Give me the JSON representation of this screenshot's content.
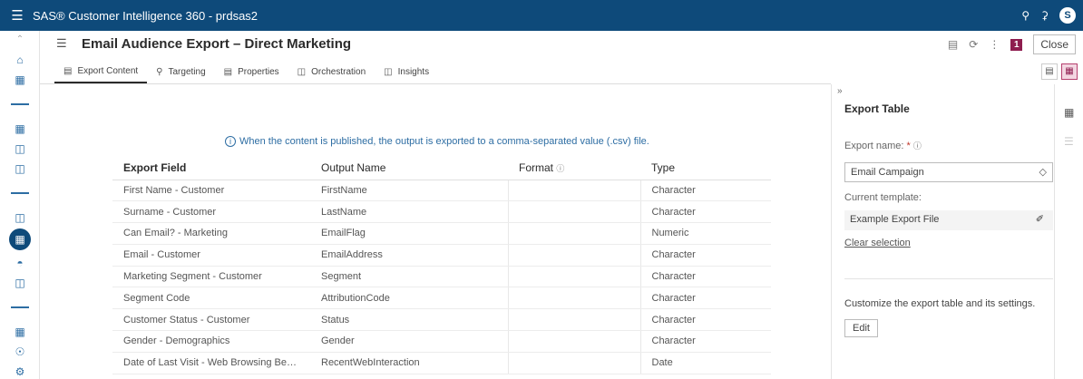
{
  "topbar": {
    "app_title": "SAS® Customer Intelligence 360 - prdsas2",
    "avatar_letter": "S"
  },
  "header": {
    "title": "Email Audience Export – Direct Marketing",
    "badge_count": "1",
    "close_label": "Close"
  },
  "tabs": [
    {
      "label": "Export Content",
      "icon": "document-icon"
    },
    {
      "label": "Targeting",
      "icon": "target-icon"
    },
    {
      "label": "Properties",
      "icon": "properties-icon"
    },
    {
      "label": "Orchestration",
      "icon": "orchestration-icon"
    },
    {
      "label": "Insights",
      "icon": "insights-icon"
    }
  ],
  "main": {
    "info_text": "When the content is published, the output is exported to a comma-separated value (.csv) file.",
    "columns": [
      "Export Field",
      "Output Name",
      "Format",
      "Type"
    ],
    "rows": [
      {
        "field": "First Name - Customer",
        "output": "FirstName",
        "format": "",
        "type": "Character"
      },
      {
        "field": "Surname - Customer",
        "output": "LastName",
        "format": "",
        "type": "Character"
      },
      {
        "field": "Can Email? - Marketing",
        "output": "EmailFlag",
        "format": "",
        "type": "Numeric"
      },
      {
        "field": "Email - Customer",
        "output": "EmailAddress",
        "format": "",
        "type": "Character"
      },
      {
        "field": "Marketing Segment - Customer",
        "output": "Segment",
        "format": "",
        "type": "Character"
      },
      {
        "field": "Segment Code",
        "output": "AttributionCode",
        "format": "",
        "type": "Character"
      },
      {
        "field": "Customer Status - Customer",
        "output": "Status",
        "format": "",
        "type": "Character"
      },
      {
        "field": "Gender - Demographics",
        "output": "Gender",
        "format": "",
        "type": "Character"
      },
      {
        "field": "Date of Last Visit - Web Browsing Be…",
        "output": "RecentWebInteraction",
        "format": "",
        "type": "Date"
      }
    ]
  },
  "panel": {
    "title": "Export Table",
    "export_name_label": "Export name:",
    "required_mark": "*",
    "export_name_value": "Email Campaign",
    "current_template_label": "Current template:",
    "current_template_value": "Example Export File",
    "clear_selection": "Clear selection",
    "description": "Customize the export table and its settings.",
    "edit_label": "Edit"
  },
  "colors": {
    "brand": "#0e4a7a",
    "accent_badge": "#8e1d4f",
    "link": "#2d6da3"
  }
}
